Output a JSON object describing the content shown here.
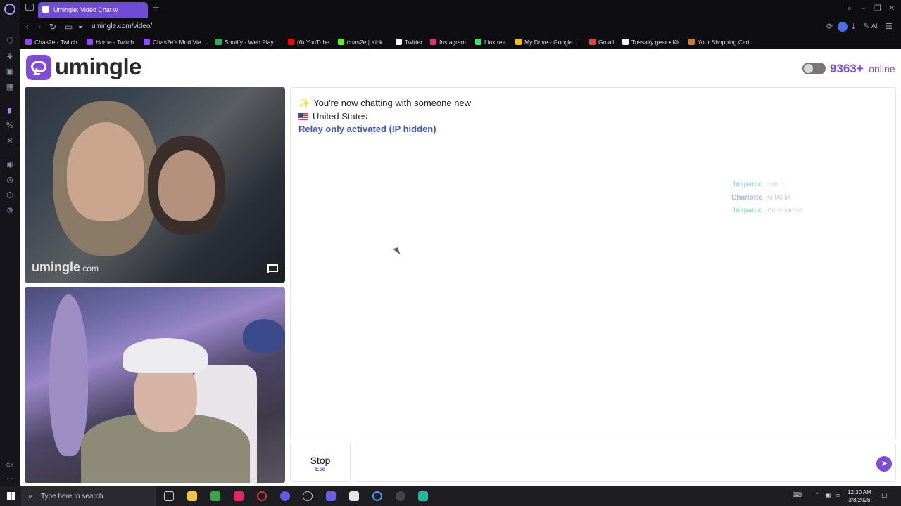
{
  "browser": {
    "tab_title": "Umingle: Video Chat w",
    "new_tab": "+",
    "url": "umingle.com/video/",
    "ai_label": "AI",
    "bookmarks": [
      {
        "label": "Chas2e - Twitch",
        "color": "#9146ff"
      },
      {
        "label": "Home - Twitch",
        "color": "#9146ff"
      },
      {
        "label": "Chas2e's Mod Vie...",
        "color": "#9146ff"
      },
      {
        "label": "Spotify - Web Play...",
        "color": "#1db954"
      },
      {
        "label": "(6) YouTube",
        "color": "#ff0000"
      },
      {
        "label": "chas2e | Kick",
        "color": "#53fc18"
      },
      {
        "label": "Twitter",
        "color": "#ffffff"
      },
      {
        "label": "Instagram",
        "color": "#e1306c"
      },
      {
        "label": "Linktree",
        "color": "#43e660"
      },
      {
        "label": "My Drive - Google...",
        "color": "#fbbc04"
      },
      {
        "label": "Gmail",
        "color": "#ea4335"
      },
      {
        "label": "Tussalty gear • Kit",
        "color": "#ffffff"
      },
      {
        "label": "Your Shopping Cart",
        "color": "#d07a2e"
      }
    ]
  },
  "site": {
    "logo_text": "umingle",
    "online_count": "9363+",
    "online_label": "online",
    "watermark": "umingle",
    "watermark_suffix": ".com",
    "accent": "#7a4ddb"
  },
  "chat": {
    "line1": "You're now chatting with someone new",
    "line1_emoji": "✨",
    "country": "United States",
    "relay": "Relay only activated (IP hidden)",
    "ghost": [
      {
        "user": "hispanic",
        "text": "mmm",
        "cls": "u1"
      },
      {
        "user": "Charlotte",
        "text": "AHAHA",
        "cls": "u2"
      },
      {
        "user": "hispanic",
        "text": "jesus louise",
        "cls": "u1"
      }
    ]
  },
  "controls": {
    "stop_label": "Stop",
    "stop_hint": "Esc",
    "send_icon": "send-icon"
  },
  "taskbar": {
    "search_placeholder": "Type here to search",
    "time": "12:30 AM",
    "date": "3/8/2026"
  }
}
